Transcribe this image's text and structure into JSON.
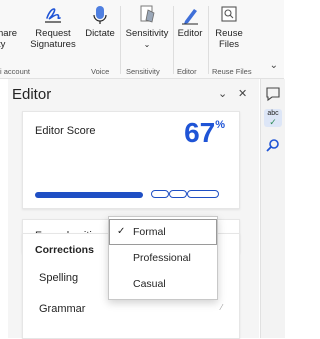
{
  "ribbon": {
    "partial_left_label_1": "hare",
    "partial_left_label_2": "ty",
    "partial_group_label": "i account",
    "request_signatures": "Request\nSignatures",
    "dictate": "Dictate",
    "sensitivity": "Sensitivity",
    "editor": "Editor",
    "reuse_files": "Reuse\nFiles",
    "groups": {
      "voice": "Voice",
      "sensitivity": "Sensitivity",
      "editor": "Editor",
      "reuse_files": "Reuse Files"
    }
  },
  "pane": {
    "title": "Editor",
    "score_card": {
      "label": "Editor Score",
      "value": "67",
      "unit": "%",
      "progress": 0.67
    },
    "formality": {
      "label": "Formal writing"
    },
    "menu": {
      "options": [
        "Formal",
        "Professional",
        "Casual"
      ],
      "selected": "Formal"
    },
    "corrections": {
      "header": "Corrections",
      "items": [
        "Spelling",
        "Grammar"
      ]
    }
  },
  "colors": {
    "accent": "#1f54d6",
    "bar": "#1f4fc4"
  },
  "icons": [
    "signature-icon",
    "microphone-icon",
    "sensitivity-icon",
    "editor-pen-icon",
    "reuse-files-icon",
    "comment-icon",
    "spellcheck-icon",
    "search-icon"
  ]
}
